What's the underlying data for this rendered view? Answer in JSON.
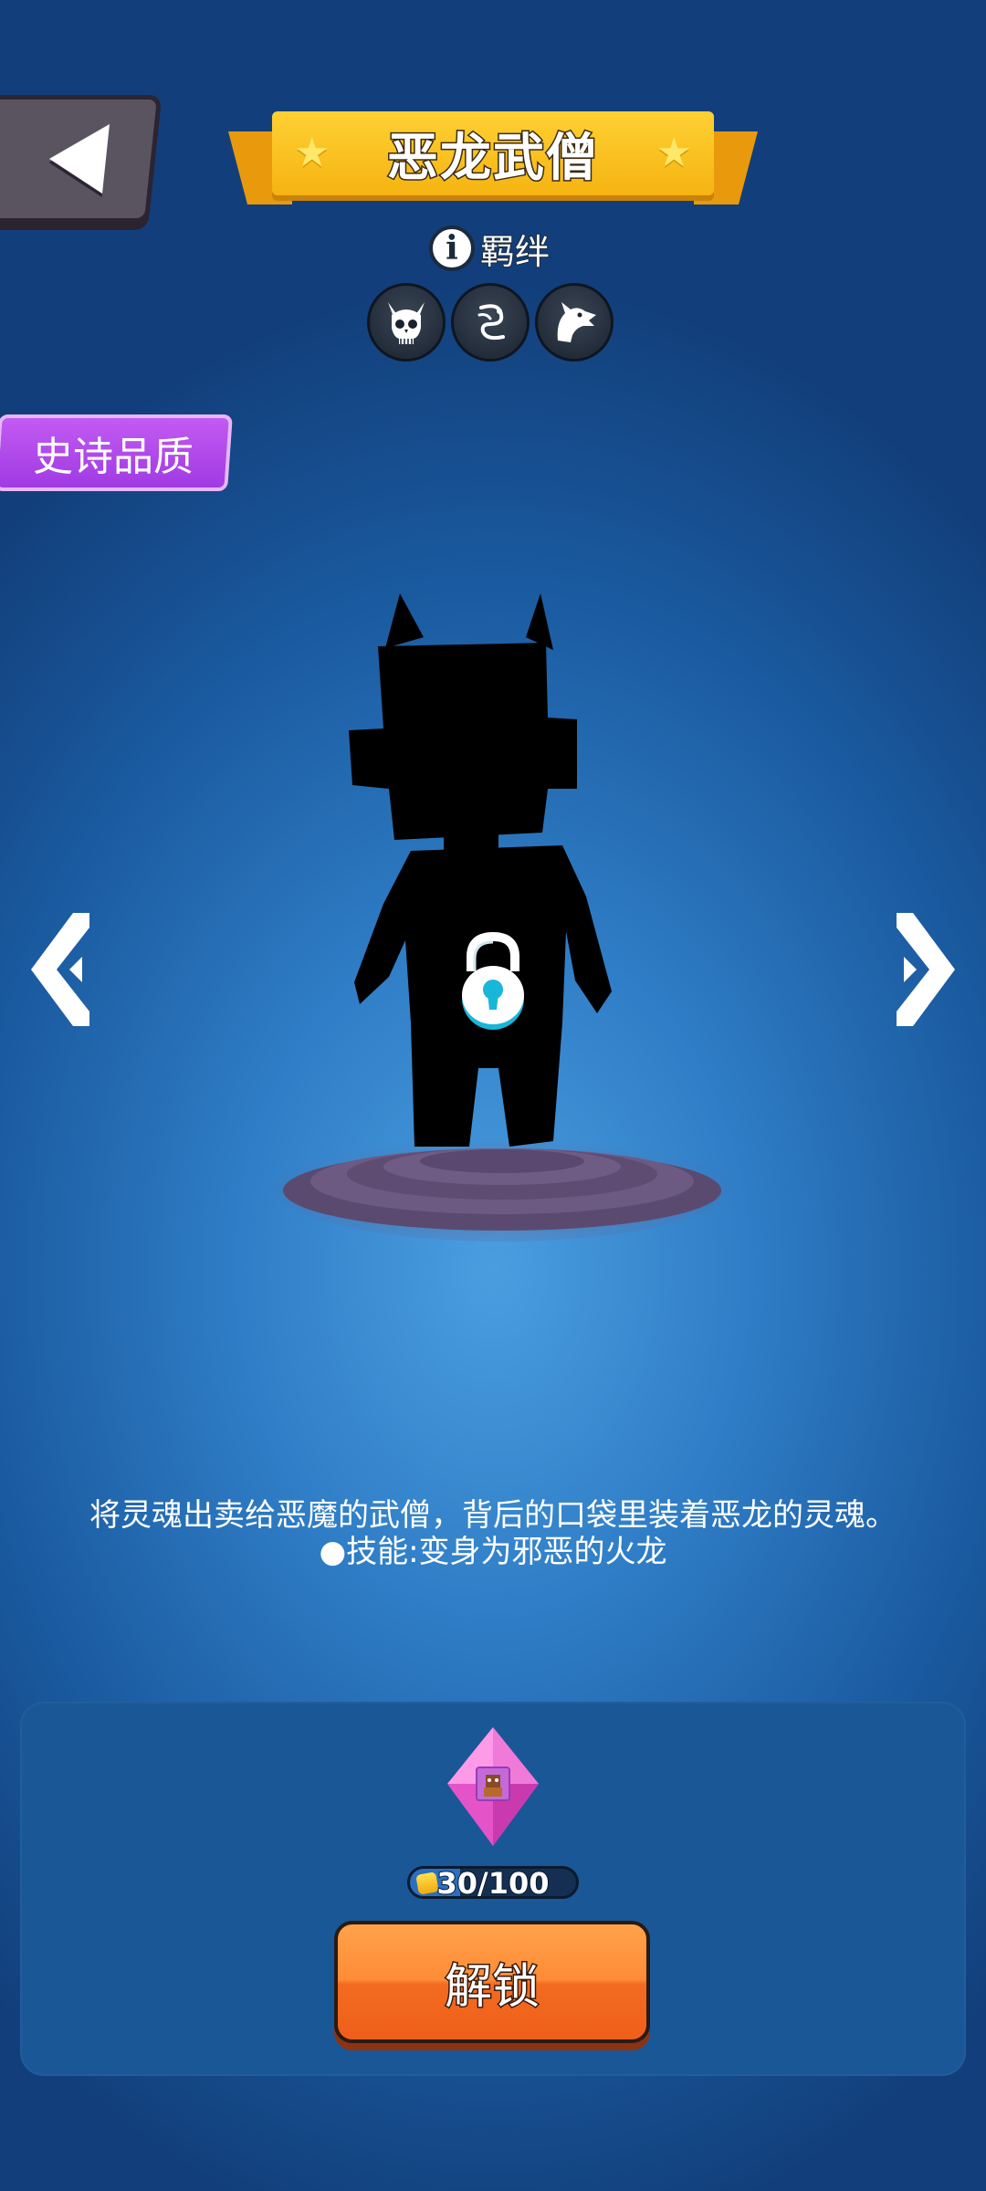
{
  "header": {
    "back_icon": "back-arrow-icon",
    "title": "恶龙武僧"
  },
  "bond": {
    "info_icon": "info-icon",
    "label": "羁绊",
    "icons": [
      "demon-skull-icon",
      "swirl-spirit-icon",
      "dragon-head-icon"
    ]
  },
  "quality": {
    "label": "史诗品质",
    "color": "#a13ae3"
  },
  "character": {
    "state": "locked",
    "lock_icon": "padlock-icon"
  },
  "navigation": {
    "prev_icon": "chevron-left-icon",
    "next_icon": "chevron-right-icon"
  },
  "description": {
    "line1": "将灵魂出卖给恶魔的武僧，背后的口袋里装着恶龙的灵魂。",
    "line2": "●技能:变身为邪恶的火龙"
  },
  "unlock_panel": {
    "shard_icon": "pink-gem-shard-icon",
    "progress_text": "30/100",
    "progress_value": 0.3,
    "button_label": "解锁",
    "button_color": "#f36b20"
  },
  "colors": {
    "title_gold": "#f5b412",
    "panel_blue": "#1a5797"
  }
}
